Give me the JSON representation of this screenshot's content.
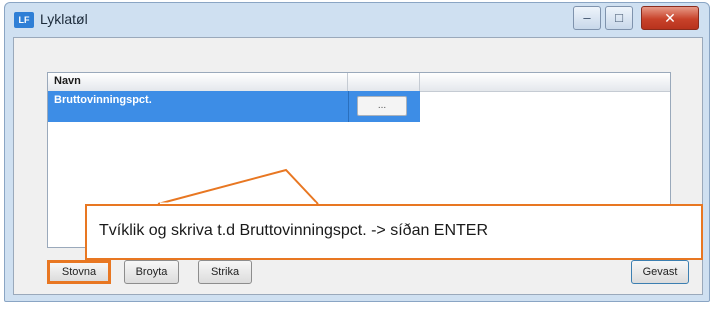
{
  "window": {
    "title": "Lyklatøl",
    "app_icon_text": "LF",
    "controls": {
      "minimize_icon": "minimize-icon",
      "maximize_icon": "maximize-icon",
      "close_icon": "close-icon"
    }
  },
  "grid": {
    "columns": [
      "Navn",
      ""
    ],
    "rows": [
      {
        "navn": "Bruttovinningspct.",
        "button_label": "..."
      }
    ]
  },
  "callout": {
    "text": "Tvíklik og skriva t.d Bruttovinningspct. -> síðan ENTER",
    "color": "#e87722"
  },
  "buttons": {
    "stovna": "Stovna",
    "broyta": "Broyta",
    "strika": "Strika",
    "gevast": "Gevast"
  },
  "colors": {
    "selection": "#3d8de6",
    "highlight": "#e87722",
    "window_frame": "#cfe0f1"
  }
}
